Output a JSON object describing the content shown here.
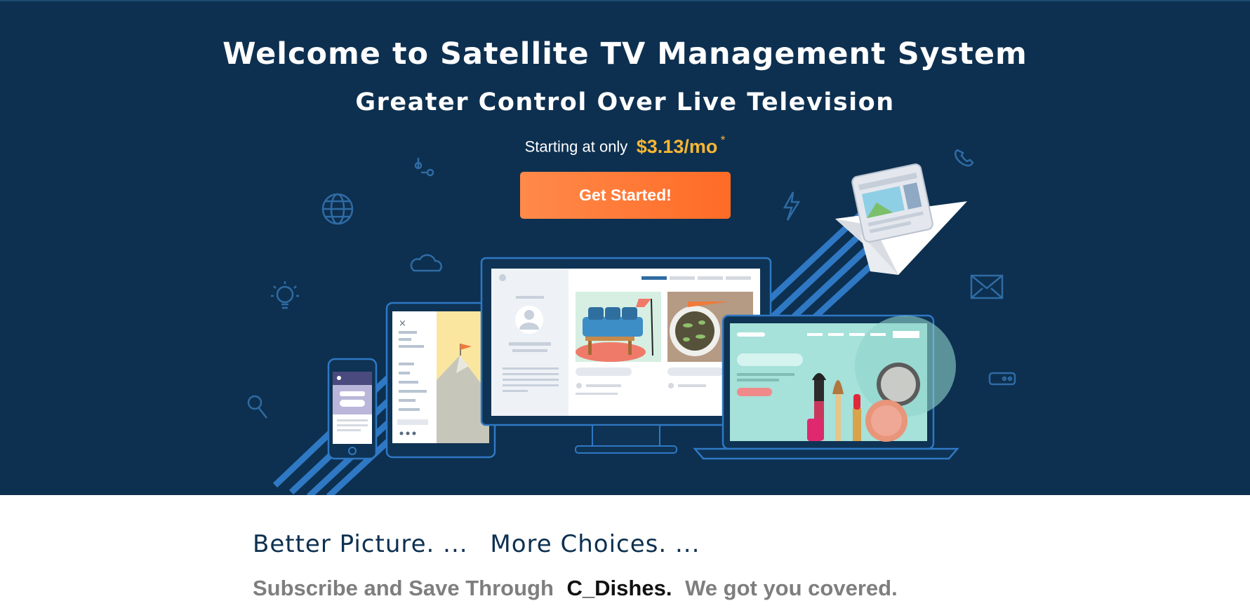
{
  "hero": {
    "title": "Welcome to Satellite TV Management System",
    "subtitle": "Greater Control Over Live Television",
    "price_prefix": "Starting at only",
    "price_value": "$3.13/mo",
    "price_asterisk": "*",
    "cta_label": "Get Started!"
  },
  "content": {
    "headline_part1": "Better Picture. ...",
    "headline_part2": "More Choices. ...",
    "subscribe_prefix": "Subscribe and Save Through",
    "brand": "C_Dishes.",
    "subscribe_suffix": "We got you covered."
  },
  "colors": {
    "hero_background": "#0d3050",
    "accent_orange": "#ff7a30",
    "price_yellow": "#f7b733",
    "stripe_blue": "#2f78c4"
  },
  "icons": [
    "flow-icon",
    "globe-icon",
    "cloud-icon",
    "lightbulb-icon",
    "search-icon",
    "lightning-icon",
    "phone-icon",
    "mail-icon",
    "toggle-icon",
    "paper-plane-icon"
  ]
}
